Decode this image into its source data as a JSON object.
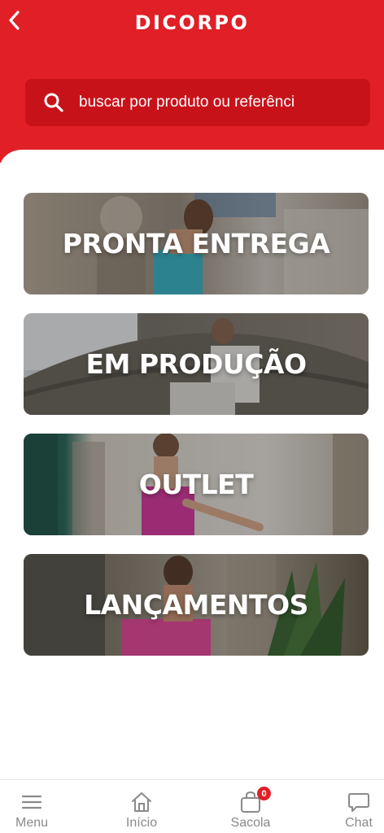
{
  "header": {
    "logo": "DICORPO",
    "back_icon": "chevron-left-icon",
    "search": {
      "placeholder": "buscar por produto ou referênci",
      "icon": "search-icon"
    }
  },
  "categories": [
    {
      "label": "PRONTA ENTREGA"
    },
    {
      "label": "EM PRODUÇÃO"
    },
    {
      "label": "OUTLET"
    },
    {
      "label": "LANÇAMENTOS"
    }
  ],
  "bottom_nav": [
    {
      "label": "Menu",
      "icon": "hamburger-menu-icon"
    },
    {
      "label": "Início",
      "icon": "home-icon"
    },
    {
      "label": "Sacola",
      "icon": "shopping-bag-icon",
      "badge": "0"
    },
    {
      "label": "Chat",
      "icon": "chat-bubble-icon"
    }
  ],
  "colors": {
    "brand_red": "#e01f26",
    "search_bg": "#c8121a",
    "nav_text": "#8a8a8a"
  }
}
